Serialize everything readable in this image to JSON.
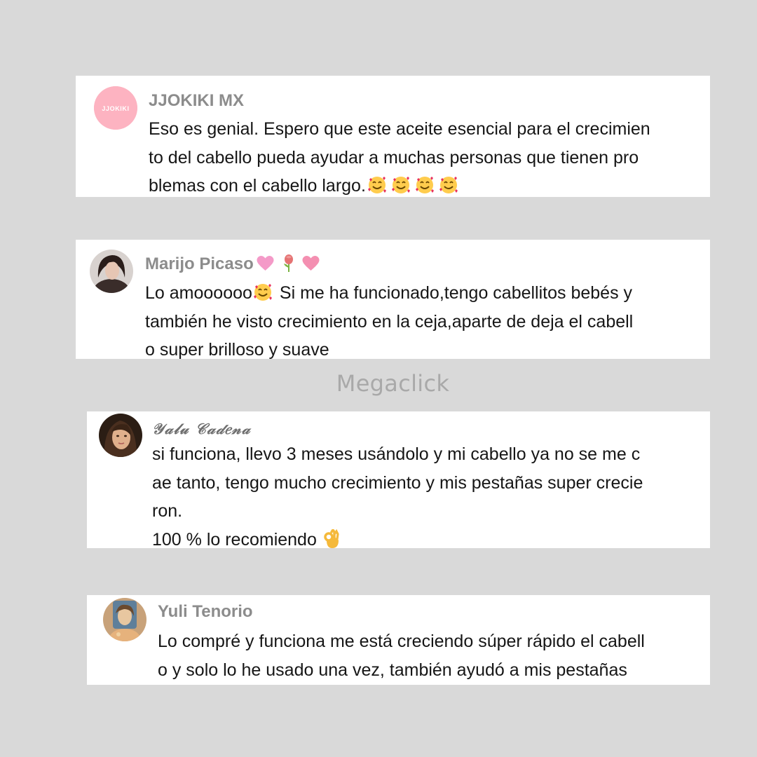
{
  "watermark": "Megaclick",
  "comments": [
    {
      "username": "JJOKIKI MX",
      "avatar_text": "JJOKIKI",
      "lines": [
        "Eso es genial. Espero que este aceite esencial para el crecimien",
        "to del cabello pueda ayudar a muchas personas que tienen pro",
        "blemas con el cabello largo."
      ]
    },
    {
      "username": "Marijo Picaso",
      "lines": [
        "Lo amoooooo",
        "Si me ha funcionado,tengo cabellitos bebés y",
        "también he visto crecimiento en la ceja,aparte de deja el cabell",
        "o super brilloso y suave"
      ]
    },
    {
      "username": "𝒴𝒶𝓁𝓊 𝒞𝒶𝒹𝑒𝓃𝒶",
      "lines": [
        "si funciona, llevo 3 meses usándolo y mi cabello ya no se me c",
        "ae tanto, tengo mucho crecimiento y mis pestañas super crecie",
        "ron.",
        "100 % lo recomiendo"
      ]
    },
    {
      "username": "Yuli Tenorio",
      "lines": [
        "Lo compré y funciona me está creciendo súper rápido el cabell",
        "o y solo lo he usado una vez, también ayudó a mis pestañas"
      ]
    }
  ],
  "icons": {
    "smiling_face_with_hearts": "smiling-face-with-hearts-emoji",
    "pink_heart": "pink-heart-emoji",
    "rose": "wilted-rose-emoji",
    "ok_hand": "ok-hand-emoji"
  },
  "colors": {
    "background": "#d9d9d9",
    "card": "#ffffff",
    "username": "#8c8c8c",
    "text": "#161616",
    "watermark": "#a9a9a9",
    "jjokiki_avatar": "#fdb3c1"
  }
}
